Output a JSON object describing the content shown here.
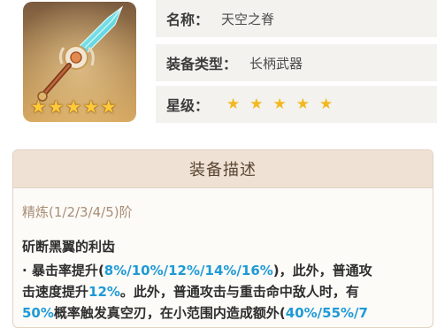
{
  "weapon": {
    "image_icon": "sword-weapon-icon",
    "portrait_stars": [
      "★",
      "★",
      "★",
      "★",
      "★"
    ],
    "name_label": "名称：",
    "name_value": "天空之脊",
    "type_label": "装备类型：",
    "type_value": "长柄武器",
    "rarity_label": "星级：",
    "rarity_stars": [
      "★",
      "★",
      "★",
      "★",
      "★"
    ]
  },
  "description": {
    "header": "装备描述",
    "refinement": "精炼(1/2/3/4/5)阶",
    "skill_name": "斫断黑翼的利齿",
    "bullet": "·",
    "line1_a": "暴击率提升(",
    "line1_hl": "8%/10%/12%/14%/16%",
    "line1_b": ")，此外，普通攻",
    "line2_a": "击速度提升",
    "line2_hl": "12%",
    "line2_b": "。此外，普通攻击与重击命中敌人时，有",
    "line3_hl1": "50%",
    "line3_a": "概率触发真空刃，在小范围内造成额外(",
    "line3_hl2": "40%/55%/7"
  },
  "colors": {
    "highlight": "#1f9ad6",
    "star_gold": "#f2b81d",
    "header_bg": "#efe1d3"
  }
}
